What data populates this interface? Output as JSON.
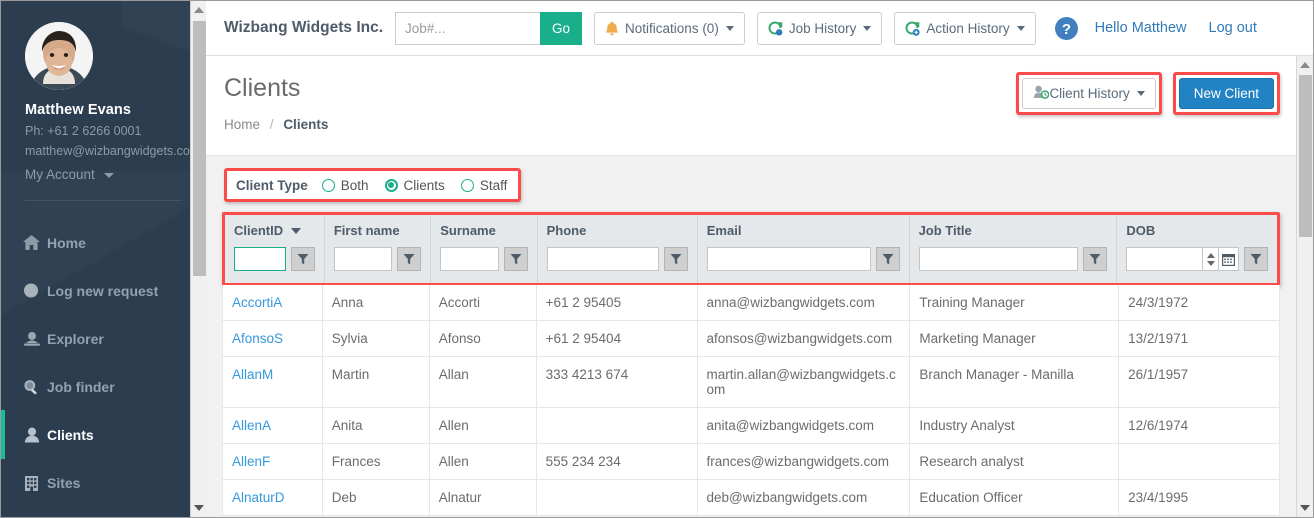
{
  "sidebar": {
    "profile": {
      "name": "Matthew Evans",
      "phone": "Ph: +61 2 6266 0001",
      "email": "matthew@wizbangwidgets.co",
      "account_menu": "My Account"
    },
    "items": [
      {
        "label": "Home",
        "icon": "home-icon",
        "active": false
      },
      {
        "label": "Log new request",
        "icon": "circle-icon",
        "active": false
      },
      {
        "label": "Explorer",
        "icon": "user-card-icon",
        "active": false
      },
      {
        "label": "Job finder",
        "icon": "magnifier-icon",
        "active": false
      },
      {
        "label": "Clients",
        "icon": "person-icon",
        "active": true
      },
      {
        "label": "Sites",
        "icon": "building-icon",
        "active": false
      }
    ]
  },
  "topbar": {
    "brand": "Wizbang Widgets Inc.",
    "search_value": "",
    "search_placeholder": "Job#...",
    "go_label": "Go",
    "notifications_label": "Notifications (0)",
    "job_history_label": "Job History",
    "action_history_label": "Action History",
    "hello_label": "Hello Matthew",
    "logout_label": "Log out"
  },
  "page": {
    "title": "Clients",
    "breadcrumb_home": "Home",
    "breadcrumb_sep": "/",
    "breadcrumb_current": "Clients",
    "client_history_label": "Client History",
    "new_client_label": "New Client"
  },
  "client_type": {
    "label": "Client Type",
    "options": [
      {
        "label": "Both",
        "selected": false
      },
      {
        "label": "Clients",
        "selected": true
      },
      {
        "label": "Staff",
        "selected": false
      }
    ]
  },
  "table": {
    "columns": [
      {
        "label": "ClientID",
        "sorted": true,
        "filter_value": "",
        "focused": true,
        "has_date_picker": false
      },
      {
        "label": "First name",
        "sorted": false,
        "filter_value": "",
        "focused": false,
        "has_date_picker": false
      },
      {
        "label": "Surname",
        "sorted": false,
        "filter_value": "",
        "focused": false,
        "has_date_picker": false
      },
      {
        "label": "Phone",
        "sorted": false,
        "filter_value": "",
        "focused": false,
        "has_date_picker": false
      },
      {
        "label": "Email",
        "sorted": false,
        "filter_value": "",
        "focused": false,
        "has_date_picker": false
      },
      {
        "label": "Job Title",
        "sorted": false,
        "filter_value": "",
        "focused": false,
        "has_date_picker": false
      },
      {
        "label": "DOB",
        "sorted": false,
        "filter_value": "",
        "focused": false,
        "has_date_picker": true
      }
    ],
    "rows": [
      {
        "client_id": "AccortiA",
        "first_name": "Anna",
        "surname": "Accorti",
        "phone": "+61 2 95405",
        "email": "anna@wizbangwidgets.com",
        "job_title": "Training Manager",
        "dob": "24/3/1972"
      },
      {
        "client_id": "AfonsoS",
        "first_name": "Sylvia",
        "surname": "Afonso",
        "phone": "+61 2 95404",
        "email": "afonsos@wizbangwidgets.com",
        "job_title": "Marketing Manager",
        "dob": "13/2/1971"
      },
      {
        "client_id": "AllanM",
        "first_name": "Martin",
        "surname": "Allan",
        "phone": "333 4213 674",
        "email": "martin.allan@wizbangwidgets.com",
        "job_title": "Branch Manager - Manilla",
        "dob": "26/1/1957"
      },
      {
        "client_id": "AllenA",
        "first_name": "Anita",
        "surname": "Allen",
        "phone": "",
        "email": "anita@wizbangwidgets.com",
        "job_title": "Industry Analyst",
        "dob": "12/6/1974"
      },
      {
        "client_id": "AllenF",
        "first_name": "Frances",
        "surname": "Allen",
        "phone": "555 234 234",
        "email": "frances@wizbangwidgets.com",
        "job_title": "Research analyst",
        "dob": ""
      },
      {
        "client_id": "AlnaturD",
        "first_name": "Deb",
        "surname": "Alnatur",
        "phone": "",
        "email": "deb@wizbangwidgets.com",
        "job_title": "Education Officer",
        "dob": "23/4/1995"
      }
    ]
  },
  "colors": {
    "sidebar_bg": "#2b3d4f",
    "accent_teal": "#1aaf8b",
    "primary_blue": "#2183c4",
    "link_blue": "#3598dc",
    "highlight_red": "#fb4b4b"
  }
}
